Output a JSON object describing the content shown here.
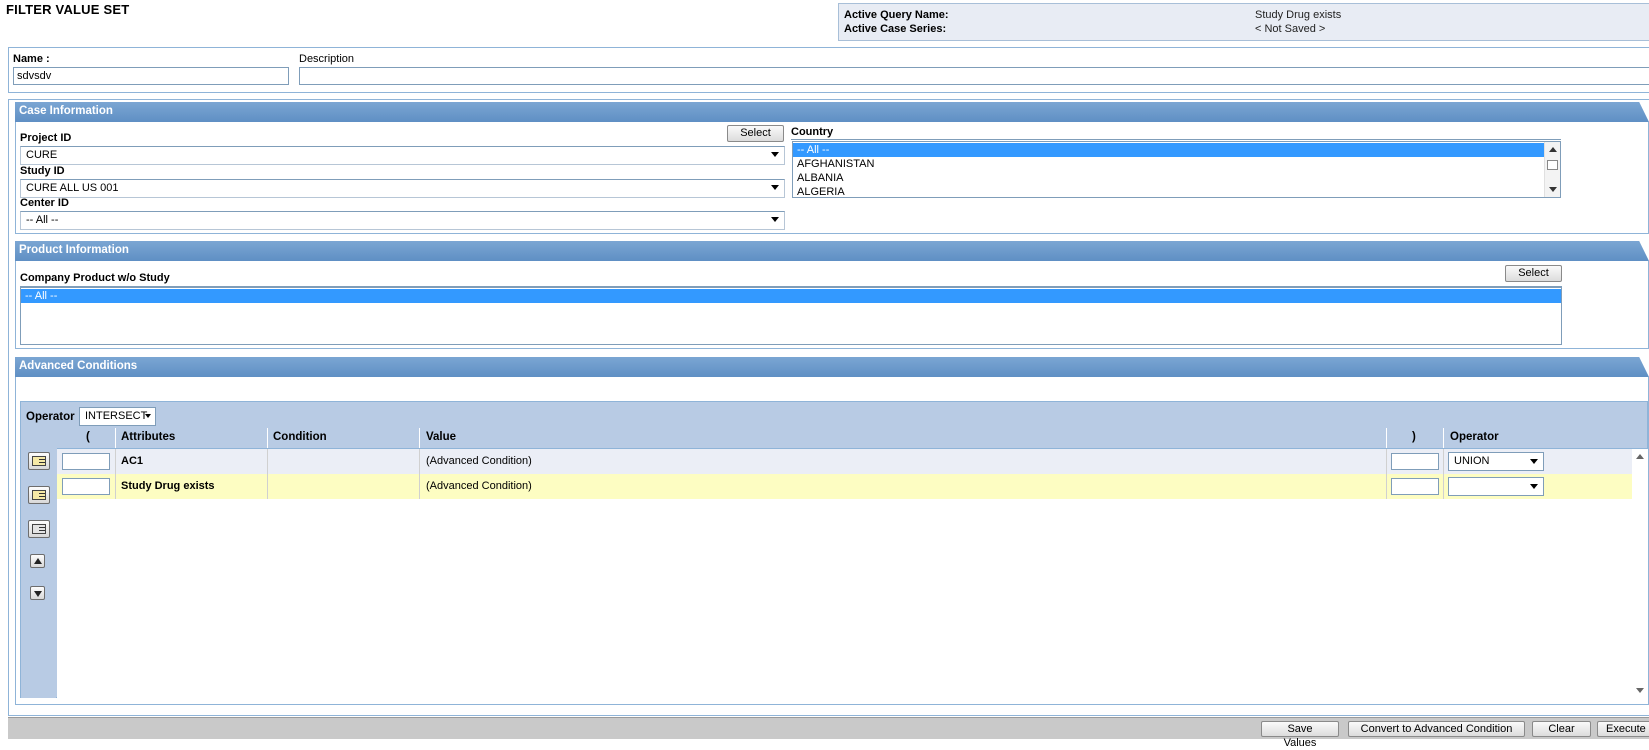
{
  "page": {
    "title": "FILTER VALUE SET"
  },
  "query_info": {
    "active_query_label": "Active Query Name:",
    "active_query_value": "Study Drug exists",
    "active_case_label": "Active Case Series:",
    "active_case_value": "< Not Saved >"
  },
  "name_section": {
    "name_label": "Name :",
    "name_value": "sdvsdv",
    "description_label": "Description",
    "description_value": ""
  },
  "case_info": {
    "header": "Case Information",
    "project_label": "Project ID",
    "project_value": "CURE",
    "select_label": "Select",
    "study_label": "Study ID",
    "study_value": "CURE ALL US 001",
    "center_label": "Center ID",
    "center_value": "-- All --",
    "country_label": "Country",
    "countries": [
      "-- All --",
      "AFGHANISTAN",
      "ALBANIA",
      "ALGERIA"
    ]
  },
  "product_info": {
    "header": "Product Information",
    "company_product_label": "Company Product w/o Study",
    "select_label": "Select",
    "items": [
      "-- All --"
    ]
  },
  "advanced": {
    "header": "Advanced Conditions",
    "operator_label": "Operator",
    "operator_value": "INTERSECT",
    "columns": {
      "open_paren": "(",
      "attributes": "Attributes",
      "condition": "Condition",
      "value": "Value",
      "close_paren": ")",
      "operator": "Operator"
    },
    "rows": [
      {
        "attribute": "AC1",
        "condition": "",
        "value": "(Advanced Condition)",
        "operator": "UNION"
      },
      {
        "attribute": "Study Drug exists",
        "condition": "",
        "value": "(Advanced Condition)",
        "operator": ""
      }
    ]
  },
  "footer": {
    "save_values": "Save Values",
    "convert": "Convert to Advanced Condition",
    "clear": "Clear",
    "execute": "Execute"
  }
}
